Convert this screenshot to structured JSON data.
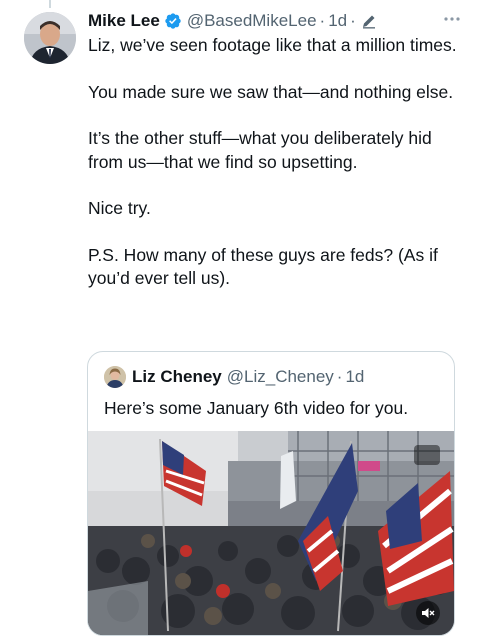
{
  "post": {
    "author_name": "Mike Lee",
    "handle": "@BasedMikeLee",
    "dot": "·",
    "time": "1d",
    "text_paragraphs": [
      "Liz, we’ve seen footage like that a million times.",
      "You made sure we saw that—and nothing else.",
      "It’s the other stuff—what you deliberately hid from us—that we find so upsetting.",
      "Nice try.",
      "P.S. How many of these guys are feds? (As if you’d ever tell us)."
    ]
  },
  "quote": {
    "author_name": "Liz Cheney",
    "handle": "@Liz_Cheney",
    "dot": "·",
    "time": "1d",
    "text": "Here’s some January 6th video for you."
  },
  "colors": {
    "verified": "#1d9bf0",
    "secondary_text": "#536471",
    "border": "#cfd9de"
  },
  "icons": {
    "verified": "verified-badge-icon",
    "edit": "edit-pencil-icon",
    "more": "more-dots-icon",
    "mute": "volume-mute-icon"
  }
}
